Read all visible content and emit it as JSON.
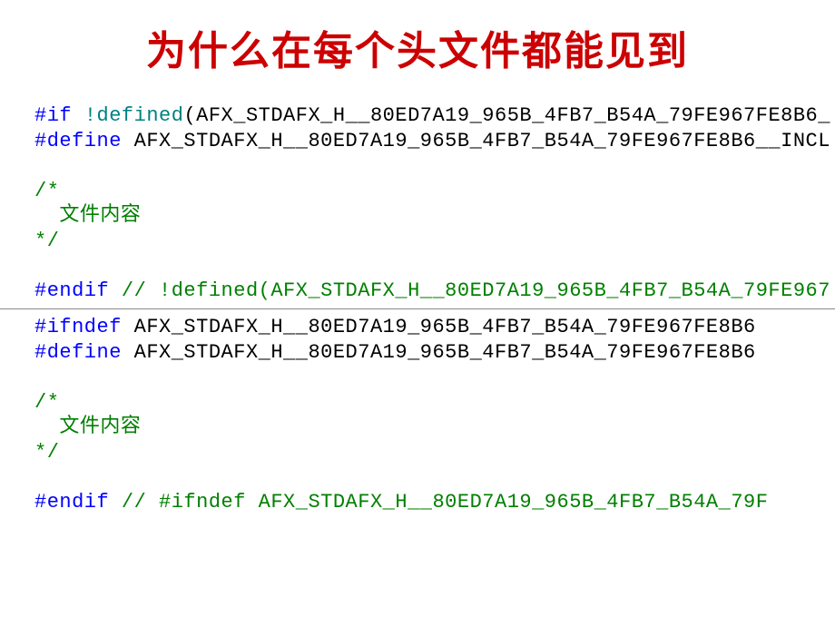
{
  "title": "为什么在每个头文件都能见到",
  "block1": {
    "line1": {
      "kw1": "#if ",
      "kw2": "!defined",
      "rest": "(AFX_STDAFX_H__80ED7A19_965B_4FB7_B54A_79FE967FE8B6_"
    },
    "line2": {
      "kw1": "#define ",
      "rest": "AFX_STDAFX_H__80ED7A19_965B_4FB7_B54A_79FE967FE8B6__INCL"
    },
    "comment_start": "/*",
    "comment_body": "  文件内容",
    "comment_end": "*/",
    "line_endif": {
      "kw": "#endif ",
      "comment": "// !defined(AFX_STDAFX_H__80ED7A19_965B_4FB7_B54A_79FE967"
    }
  },
  "block2": {
    "line1": {
      "kw1": "#ifndef ",
      "rest": "AFX_STDAFX_H__80ED7A19_965B_4FB7_B54A_79FE967FE8B6"
    },
    "line2": {
      "kw1": "#define ",
      "rest": "AFX_STDAFX_H__80ED7A19_965B_4FB7_B54A_79FE967FE8B6"
    },
    "comment_start": "/*",
    "comment_body": "  文件内容",
    "comment_end": "*/",
    "line_endif": {
      "kw": "#endif ",
      "comment": "// #ifndef AFX_STDAFX_H__80ED7A19_965B_4FB7_B54A_79F"
    }
  }
}
